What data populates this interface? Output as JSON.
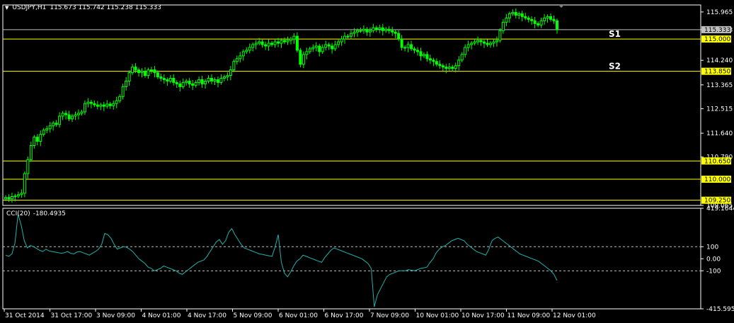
{
  "header": {
    "symbol": "USDJPY,H1",
    "ohlc": "115.673 115.742 115.238 115.333"
  },
  "cci": {
    "label": "CCI(20)",
    "value": "-180.4935"
  },
  "colors": {
    "background": "#000000",
    "border": "#ffffff",
    "bull": "#00ff00",
    "bear": "#00ff00",
    "level_line": "#ffff00",
    "bid_line": "#c0c0c0",
    "cci_line": "#20b2aa",
    "label_bg": "#ffff00",
    "price_bg": "#c0c0c0"
  },
  "chart_data": [
    {
      "type": "candlestick",
      "title": "USDJPY,H1",
      "ylim": [
        109.065,
        116.215
      ],
      "y_ticks": [
        "115.965",
        "115.333",
        "114.240",
        "113.365",
        "112.515",
        "111.640",
        "110.790",
        "109.065"
      ],
      "x_ticks": [
        "31 Oct 2014",
        "31 Oct 17:00",
        "3 Nov 09:00",
        "4 Nov 01:00",
        "4 Nov 17:00",
        "5 Nov 09:00",
        "6 Nov 01:00",
        "6 Nov 17:00",
        "7 Nov 09:00",
        "10 Nov 01:00",
        "10 Nov 17:00",
        "11 Nov 09:00",
        "12 Nov 01:00"
      ],
      "levels": [
        {
          "value": 115.0,
          "label": "115.000",
          "text": "S1"
        },
        {
          "value": 113.85,
          "label": "113.850",
          "text": "S2"
        },
        {
          "value": 110.65,
          "label": "110.650",
          "text": ""
        },
        {
          "value": 110.0,
          "label": "110.000",
          "text": ""
        },
        {
          "value": 109.25,
          "label": "109.250",
          "text": ""
        }
      ],
      "bid": {
        "value": 115.333,
        "label": "115.333"
      },
      "closes": [
        109.35,
        109.3,
        109.38,
        109.4,
        109.45,
        109.5,
        110.2,
        110.7,
        111.2,
        111.5,
        111.35,
        111.6,
        111.75,
        111.8,
        111.9,
        112.0,
        111.95,
        112.25,
        112.35,
        112.3,
        112.15,
        112.25,
        112.3,
        112.35,
        112.4,
        112.7,
        112.75,
        112.7,
        112.65,
        112.6,
        112.65,
        112.6,
        112.68,
        112.62,
        112.7,
        112.8,
        112.95,
        113.3,
        113.5,
        113.8,
        114.0,
        113.9,
        113.8,
        113.85,
        113.7,
        113.9,
        113.9,
        113.8,
        113.65,
        113.6,
        113.55,
        113.5,
        113.6,
        113.45,
        113.4,
        113.3,
        113.45,
        113.5,
        113.4,
        113.35,
        113.45,
        113.55,
        113.4,
        113.5,
        113.6,
        113.5,
        113.55,
        113.45,
        113.6,
        113.65,
        113.7,
        113.9,
        114.2,
        114.3,
        114.4,
        114.55,
        114.6,
        114.7,
        114.8,
        114.85,
        114.9,
        114.8,
        114.75,
        114.85,
        114.8,
        114.9,
        114.85,
        114.95,
        114.9,
        114.95,
        115.0,
        115.1,
        114.6,
        114.1,
        114.45,
        114.55,
        114.65,
        114.7,
        114.75,
        114.55,
        114.7,
        114.8,
        114.75,
        114.65,
        114.8,
        114.9,
        115.0,
        115.1,
        115.1,
        115.2,
        115.25,
        115.3,
        115.3,
        115.35,
        115.25,
        115.3,
        115.4,
        115.35,
        115.4,
        115.3,
        115.35,
        115.3,
        115.25,
        115.2,
        115.0,
        114.7,
        114.7,
        114.8,
        114.65,
        114.6,
        114.55,
        114.4,
        114.45,
        114.3,
        114.25,
        114.2,
        114.1,
        114.05,
        114.0,
        113.95,
        114.0,
        113.95,
        114.05,
        114.25,
        114.45,
        114.7,
        114.8,
        114.85,
        114.9,
        114.95,
        114.9,
        114.85,
        114.8,
        114.85,
        114.9,
        114.95,
        115.3,
        115.6,
        115.75,
        115.9,
        115.95,
        115.85,
        115.9,
        115.8,
        115.75,
        115.7,
        115.65,
        115.55,
        115.5,
        115.65,
        115.75,
        115.8,
        115.7,
        115.65,
        115.33
      ]
    },
    {
      "type": "line",
      "title": "CCI(20)",
      "ylim": [
        -415.5955,
        419.1644
      ],
      "y_ticks": [
        "419.1644",
        "100",
        "0.00",
        "-100",
        "-415.5955"
      ],
      "levels": [
        100,
        -100
      ],
      "values": [
        30,
        20,
        40,
        130,
        370,
        280,
        150,
        90,
        110,
        100,
        85,
        70,
        60,
        80,
        65,
        60,
        55,
        50,
        45,
        50,
        60,
        45,
        40,
        55,
        60,
        50,
        40,
        30,
        45,
        60,
        80,
        120,
        210,
        200,
        170,
        120,
        80,
        90,
        100,
        95,
        80,
        60,
        30,
        0,
        -20,
        -40,
        -70,
        -80,
        -100,
        -90,
        -80,
        -60,
        -70,
        -80,
        -90,
        -100,
        -120,
        -130,
        -110,
        -90,
        -70,
        -50,
        -30,
        -20,
        -10,
        20,
        60,
        100,
        140,
        160,
        120,
        150,
        220,
        250,
        200,
        160,
        120,
        90,
        80,
        70,
        60,
        50,
        40,
        35,
        30,
        25,
        20,
        100,
        200,
        -30,
        -120,
        -150,
        -110,
        -60,
        -20,
        0,
        30,
        20,
        10,
        0,
        -10,
        -20,
        -30,
        10,
        40,
        70,
        90,
        80,
        70,
        60,
        50,
        40,
        30,
        20,
        10,
        0,
        -20,
        -40,
        -80,
        -400,
        -300,
        -250,
        -200,
        -150,
        -130,
        -120,
        -110,
        -100,
        -100,
        -100,
        -90,
        -95,
        -100,
        -90,
        -80,
        -75,
        -70,
        -30,
        0,
        50,
        80,
        100,
        110,
        130,
        150,
        160,
        170,
        160,
        150,
        120,
        100,
        80,
        60,
        50,
        40,
        30,
        80,
        150,
        170,
        180,
        160,
        140,
        120,
        100,
        80,
        60,
        40,
        30,
        20,
        10,
        0,
        -10,
        -20,
        -40,
        -60,
        -80,
        -100,
        -130,
        -180
      ]
    }
  ]
}
